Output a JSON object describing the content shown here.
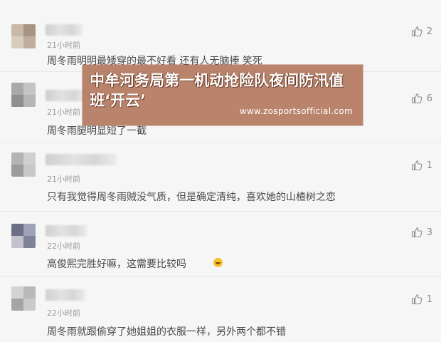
{
  "comments": [
    {
      "time": "21小时前",
      "text": "周冬雨明明最矮穿的最不好看 还有人无脑捧 笑死",
      "likes": "2"
    },
    {
      "time": "21小时前",
      "text": "周冬雨腿明显短了一截",
      "likes": "6"
    },
    {
      "time": "21小时前",
      "text": "只有我觉得周冬雨贼没气质，但是确定清纯，喜欢她的山楂树之恋",
      "likes": "1"
    },
    {
      "time": "22小时前",
      "text": "高俊熙完胜好嘛，这需要比较吗",
      "likes": "3"
    },
    {
      "time": "22小时前",
      "text": "周冬雨就跟偷穿了她姐姐的衣服一样，另外两个都不错",
      "likes": "1"
    }
  ],
  "icons": {
    "like": "thumbs-up-icon",
    "emoji": "laughing-emoji-icon"
  },
  "banner": {
    "title": "中牟河务局第一机动抢险队夜间防汛值班‘开云’",
    "url": "www.zosportsofficial.com"
  },
  "colors": {
    "banner_bg": "#b07054",
    "text": "#4a4a4a",
    "muted": "#9a9a9a",
    "background": "#f6f6f6"
  }
}
